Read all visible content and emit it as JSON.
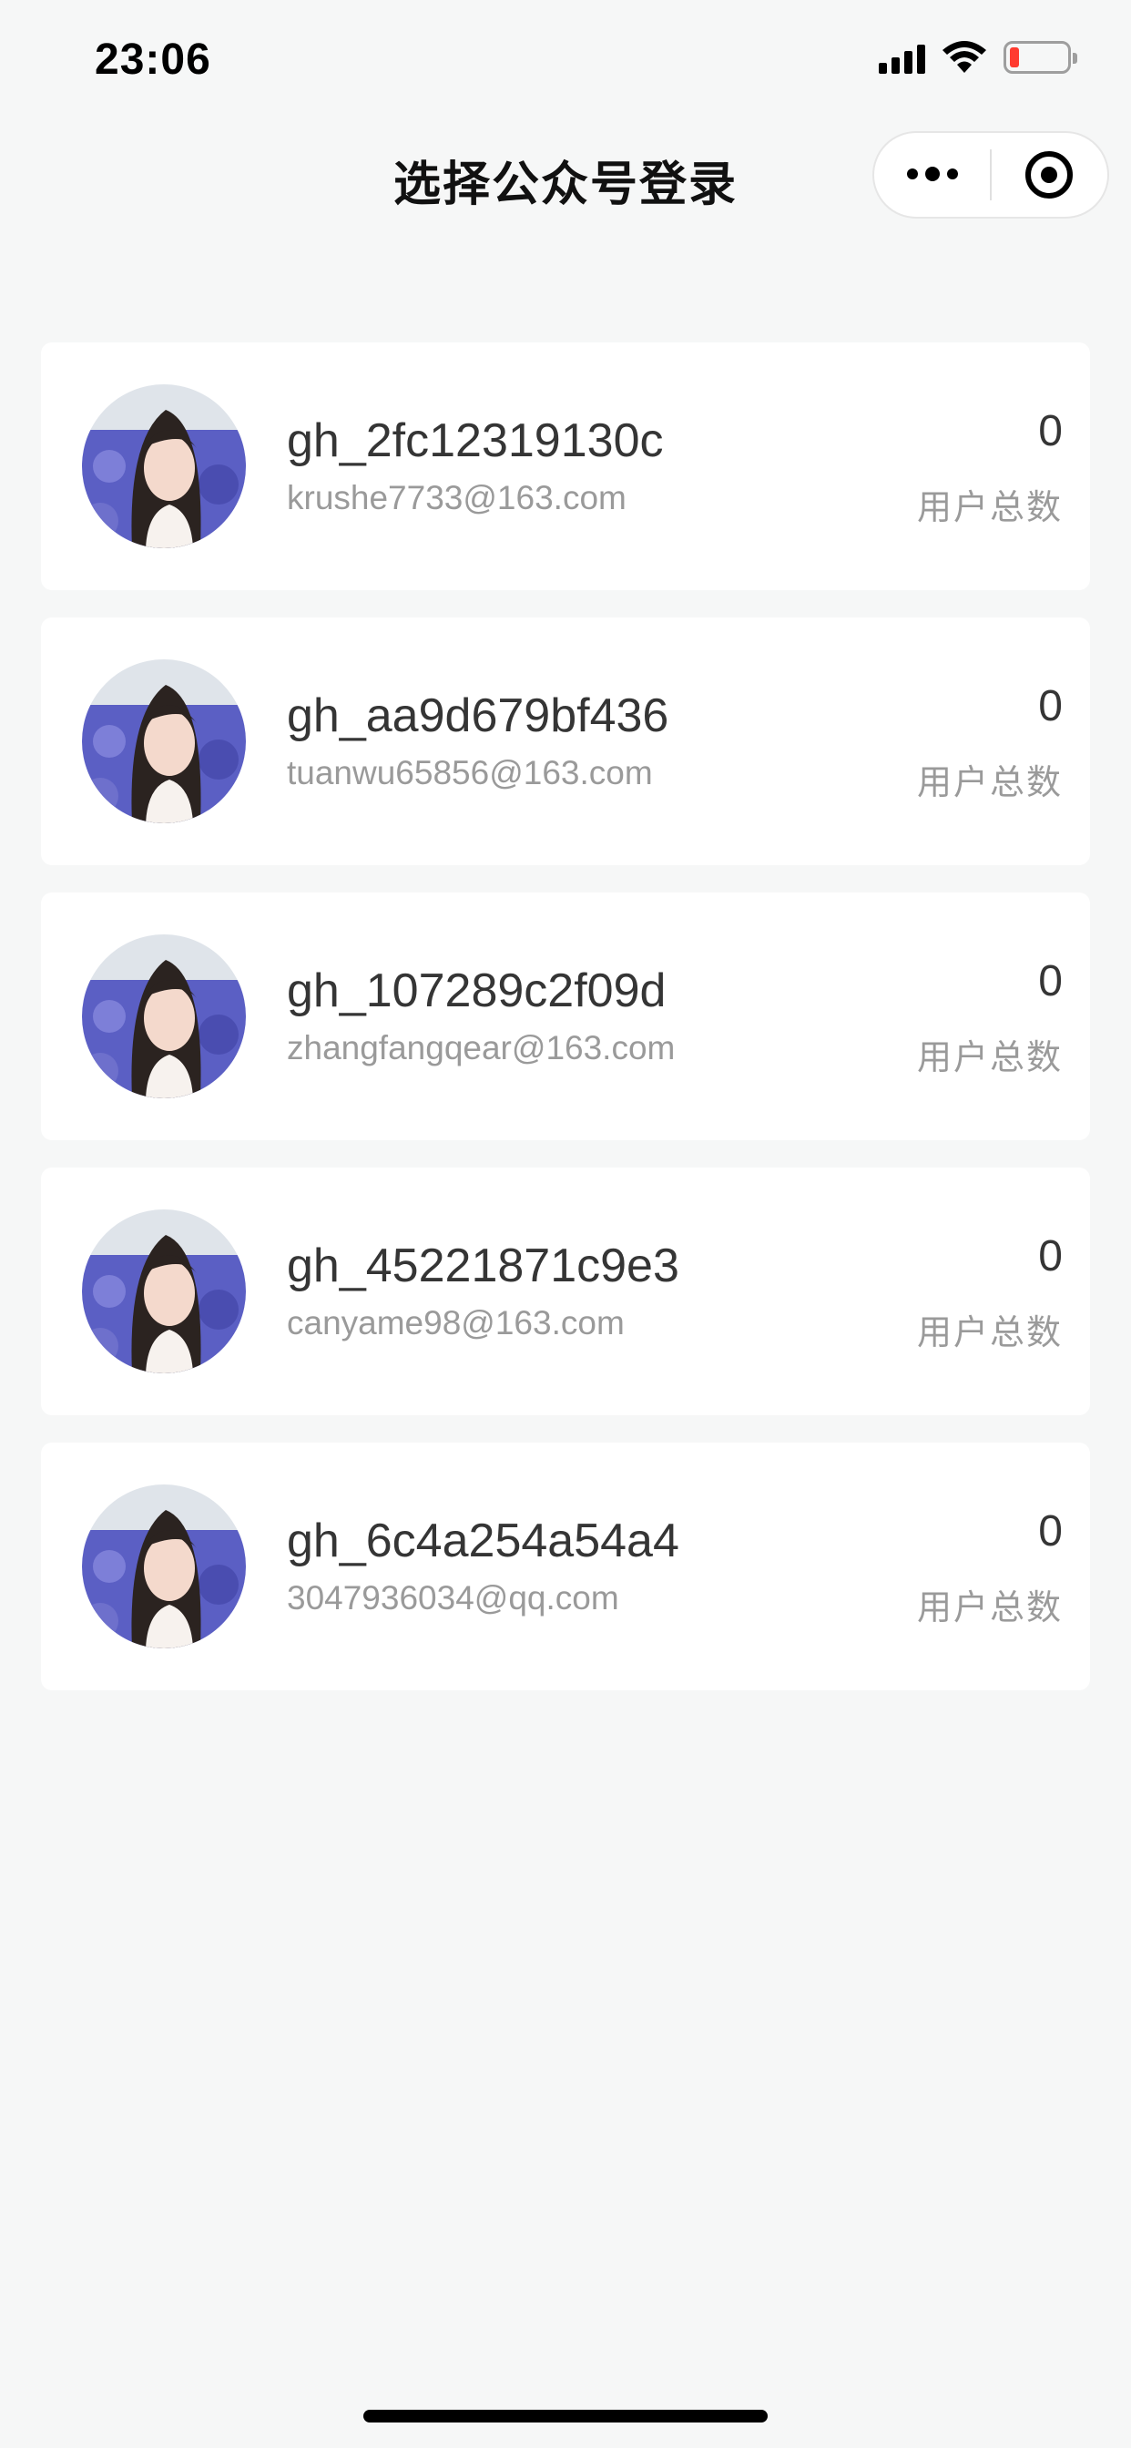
{
  "status_bar": {
    "time": "23:06",
    "icons": [
      "cellular-signal-icon",
      "wifi-icon",
      "battery-low-icon"
    ],
    "battery_color": "#ff3b30"
  },
  "nav": {
    "title": "选择公众号登录",
    "capsule_icons": [
      "more-icon",
      "close-icon"
    ]
  },
  "accounts": [
    {
      "name": "gh_2fc12319130c",
      "email": "krushe7733@163.com",
      "user_count": "0",
      "user_count_label": "用户总数"
    },
    {
      "name": "gh_aa9d679bf436",
      "email": "tuanwu65856@163.com",
      "user_count": "0",
      "user_count_label": "用户总数"
    },
    {
      "name": "gh_107289c2f09d",
      "email": "zhangfangqear@163.com",
      "user_count": "0",
      "user_count_label": "用户总数"
    },
    {
      "name": "gh_45221871c9e3",
      "email": "canyame98@163.com",
      "user_count": "0",
      "user_count_label": "用户总数"
    },
    {
      "name": "gh_6c4a254a54a4",
      "email": "3047936034@qq.com",
      "user_count": "0",
      "user_count_label": "用户总数"
    }
  ],
  "colors": {
    "background": "#f6f7f7",
    "card": "#ffffff",
    "primary_text": "#353535",
    "secondary_text": "#9a9a9a"
  }
}
